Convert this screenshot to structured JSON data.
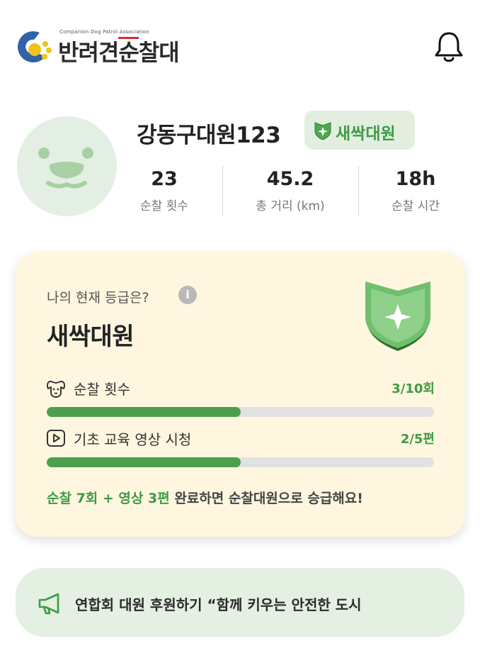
{
  "header": {
    "logo_subtitle": "Companion Dog Patrol Association",
    "logo_title_part1": "반려견",
    "logo_title_accent": "순",
    "logo_title_part2": "찰대",
    "notification_icon": "bell-icon"
  },
  "profile": {
    "avatar_icon": "dog-face-avatar",
    "nickname": "강동구대원123",
    "grade_badge": "새싹대원",
    "stats": [
      {
        "value": "23",
        "label": "순찰 횟수"
      },
      {
        "value": "45.2",
        "label": "총 거리 (km)"
      },
      {
        "value": "18h",
        "label": "순찰 시간"
      }
    ]
  },
  "grade_card": {
    "question": "나의 현재 등급은?",
    "grade_name": "새싹대원",
    "progress": [
      {
        "icon": "dog-icon",
        "label": "순찰 횟수",
        "value_text": "3/10회",
        "fraction": 0.5
      },
      {
        "icon": "play-icon",
        "label": "기초 교육 영상 시청",
        "value_text": "2/5편",
        "fraction": 0.5
      }
    ],
    "note_highlight": "순찰 7회 + 영상 3편",
    "note_rest": " 완료하면 순찰대원으로 승급해요!"
  },
  "banner": {
    "icon": "megaphone-icon",
    "text": "연합회 대원 후원하기 “함께 키우는 안전한 도시"
  },
  "colors": {
    "accent_green": "#3f9b45",
    "bar_green": "#4b9f4d",
    "card_bg": "#fff6e0",
    "chip_bg": "#e2efdf",
    "banner_bg": "#e3f0e2",
    "logo_blue": "#2f62a8",
    "logo_yellow": "#f1c21b",
    "logo_red": "#d92b2b"
  }
}
